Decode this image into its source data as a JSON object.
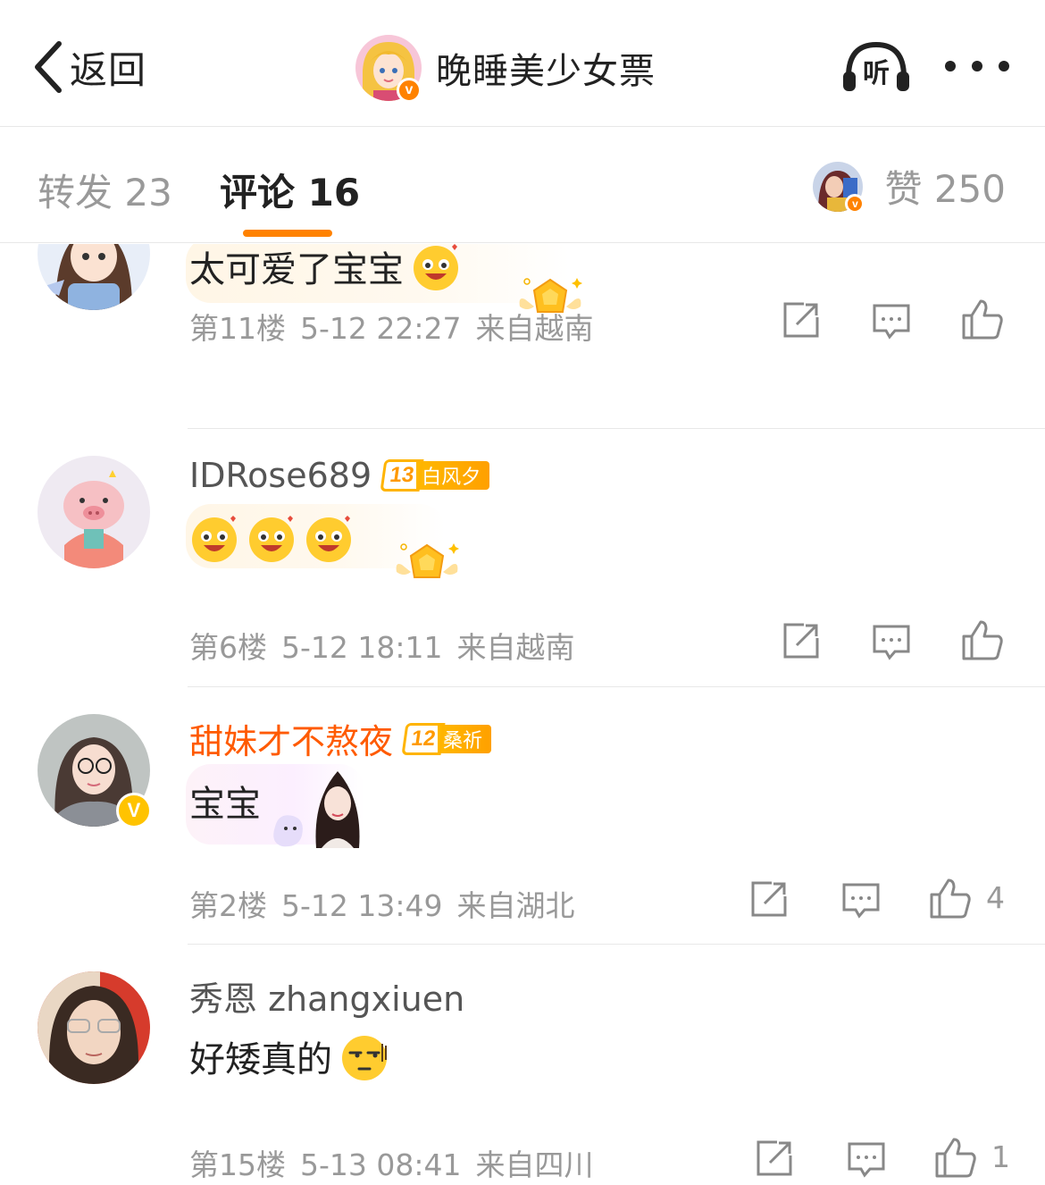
{
  "header": {
    "back_label": "返回",
    "title": "晚睡美少女票",
    "listen_icon": "listen-headphone-icon",
    "more_icon": "more-dots-icon",
    "verified_mark": "v"
  },
  "tabs": {
    "repost": "转发 23",
    "comment": "评论 16",
    "likes": "赞 250",
    "accent_color": "#ff8200"
  },
  "comments": [
    {
      "name": "",
      "text": "太可爱了宝宝",
      "floor": "第11楼",
      "time": "5-12 22:27",
      "location": "来自越南",
      "like_count": ""
    },
    {
      "name": "IDRose689",
      "level": "13",
      "tag": "白风夕",
      "text": "",
      "floor": "第6楼",
      "time": "5-12 18:11",
      "location": "来自越南",
      "like_count": ""
    },
    {
      "name": "甜妹才不熬夜",
      "level": "12",
      "tag": "桑祈",
      "text": "宝宝",
      "floor": "第2楼",
      "time": "5-12 13:49",
      "location": "来自湖北",
      "like_count": "4",
      "verified_mark": "V"
    },
    {
      "name": "秀恩 zhangxiuen",
      "text": "好矮真的",
      "floor": "第15楼",
      "time": "5-13 08:41",
      "location": "来自四川",
      "like_count": "1"
    }
  ]
}
